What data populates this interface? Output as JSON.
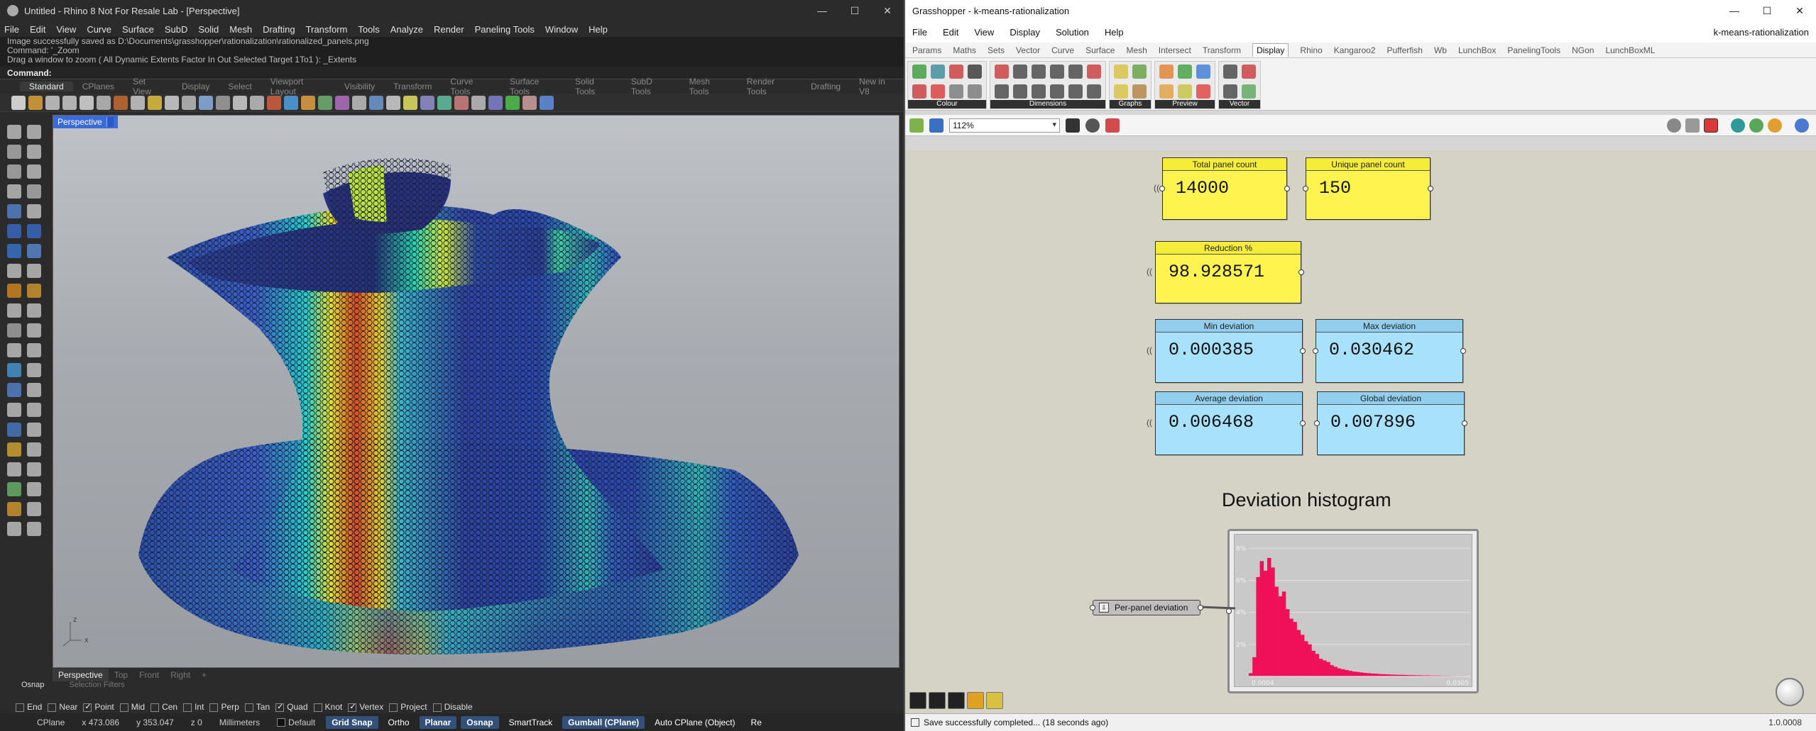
{
  "rhino": {
    "title": "Untitled - Rhino 8 Not For Resale Lab - [Perspective]",
    "menu": [
      "File",
      "Edit",
      "View",
      "Curve",
      "Surface",
      "SubD",
      "Solid",
      "Mesh",
      "Drafting",
      "Transform",
      "Tools",
      "Analyze",
      "Render",
      "Paneling Tools",
      "Window",
      "Help"
    ],
    "history": [
      "Image successfully saved as D:\\Documents\\grasshopper\\rationalization\\rationalized_panels.png",
      "Command: '_Zoom",
      "Drag a window to zoom ( All  Dynamic  Extents  Factor  In  Out  Selected  Target  1To1 ): _Extents"
    ],
    "command_label": "Command:",
    "tabs": [
      "Standard",
      "CPlanes",
      "Set View",
      "Display",
      "Select",
      "Viewport Layout",
      "Visibility",
      "Transform",
      "Curve Tools",
      "Surface Tools",
      "Solid Tools",
      "SubD Tools",
      "Mesh Tools",
      "Render Tools",
      "Drafting",
      "New in V8"
    ],
    "viewport_name": "Perspective",
    "viewport_tabs": [
      "Perspective",
      "Top",
      "Front",
      "Right",
      "+"
    ],
    "osnap_header": "Osnap",
    "selection_filters": "Selection Filters",
    "osnaps": [
      {
        "label": "End",
        "checked": false
      },
      {
        "label": "Near",
        "checked": false
      },
      {
        "label": "Point",
        "checked": true
      },
      {
        "label": "Mid",
        "checked": false
      },
      {
        "label": "Cen",
        "checked": false
      },
      {
        "label": "Int",
        "checked": false
      },
      {
        "label": "Perp",
        "checked": false
      },
      {
        "label": "Tan",
        "checked": false
      },
      {
        "label": "Quad",
        "checked": true
      },
      {
        "label": "Knot",
        "checked": false
      },
      {
        "label": "Vertex",
        "checked": true
      },
      {
        "label": "Project",
        "checked": false
      },
      {
        "label": "Disable",
        "checked": false
      }
    ],
    "status": {
      "cplane": "CPlane",
      "x": "x 473.086",
      "y": "y 353.047",
      "z": "z 0",
      "units": "Millimeters",
      "layer": "Default",
      "grid_snap": "Grid Snap",
      "ortho": "Ortho",
      "planar": "Planar",
      "osnap": "Osnap",
      "smarttrack": "SmartTrack",
      "gumball": "Gumball (CPlane)",
      "auto_cplane": "Auto CPlane (Object)",
      "record": "Re"
    },
    "axis": {
      "z": "z",
      "x": "x"
    }
  },
  "grasshopper": {
    "title": "Grasshopper - k-means-rationalization",
    "menu": [
      "File",
      "Edit",
      "View",
      "Display",
      "Solution",
      "Help"
    ],
    "document_name": "k-means-rationalization",
    "tabs": [
      "Params",
      "Maths",
      "Sets",
      "Vector",
      "Curve",
      "Surface",
      "Mesh",
      "Intersect",
      "Transform",
      "Display",
      "Rhino",
      "Kangaroo2",
      "Pufferfish",
      "Wb",
      "LunchBox",
      "PanelingTools",
      "NGon",
      "LunchBoxML"
    ],
    "active_tab": "Display",
    "ribbon_groups": [
      "Colour",
      "Dimensions",
      "Graphs",
      "Preview",
      "Vector"
    ],
    "zoom": "112%",
    "panels": {
      "total_panel_count": {
        "label": "Total panel count",
        "value": "14000"
      },
      "unique_panel_count": {
        "label": "Unique panel count",
        "value": "150"
      },
      "reduction": {
        "label": "Reduction %",
        "value": "98.928571"
      },
      "min_deviation": {
        "label": "Min deviation",
        "value": "0.000385"
      },
      "max_deviation": {
        "label": "Max deviation",
        "value": "0.030462"
      },
      "average_deviation": {
        "label": "Average deviation",
        "value": "0.006468"
      },
      "global_deviation": {
        "label": "Global deviation",
        "value": "0.007896"
      }
    },
    "histogram_title": "Deviation histogram",
    "per_panel_label": "Per-panel deviation",
    "status": "Save successfully completed... (18 seconds ago)",
    "version": "1.0.0008",
    "colors": {
      "histogram_bar": "#f0105a",
      "yellow_panel": "#fff44f",
      "blue_panel": "#a8e1fb"
    }
  },
  "chart_data": {
    "type": "bar",
    "title": "",
    "y_tick_labels": [
      "8%",
      "6%",
      "4%",
      "2%"
    ],
    "x_tick_labels": [
      "0.0004",
      "0.0305"
    ],
    "x_range": [
      0.0004,
      0.0305
    ],
    "ylim": [
      0,
      8.5
    ],
    "values": [
      0.2,
      1.2,
      6.2,
      7.2,
      6.6,
      7.4,
      6.8,
      5.6,
      5.0,
      5.3,
      4.2,
      3.6,
      3.4,
      2.9,
      2.6,
      2.2,
      2.0,
      1.6,
      1.4,
      1.1,
      1.0,
      0.9,
      0.7,
      0.6,
      0.5,
      0.45,
      0.4,
      0.35,
      0.3,
      0.28,
      0.25,
      0.22,
      0.2,
      0.18,
      0.17,
      0.15,
      0.14,
      0.13,
      0.12,
      0.11,
      0.1,
      0.1,
      0.09,
      0.08,
      0.08,
      0.07,
      0.07,
      0.06,
      0.06,
      0.05,
      0.05,
      0.05,
      0.04,
      0.04,
      0.04,
      0.03,
      0.03,
      0.03,
      0.03,
      0.02
    ]
  }
}
